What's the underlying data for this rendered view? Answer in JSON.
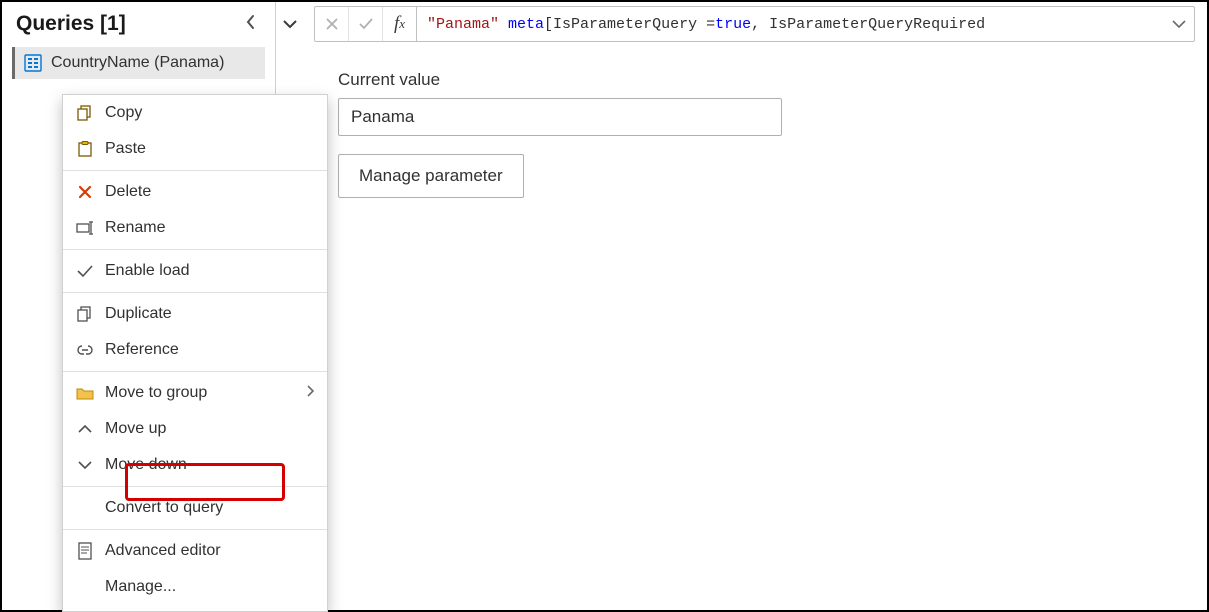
{
  "sidebar": {
    "title": "Queries [1]",
    "item_label": "CountryName (Panama)"
  },
  "formula": {
    "str": "\"Panama\"",
    "kw": "meta",
    "rest1": " [IsParameterQuery = ",
    "val": "true",
    "rest2": ", IsParameterQueryRequired"
  },
  "main": {
    "current_value_label": "Current value",
    "current_value": "Panama",
    "manage_button": "Manage parameter"
  },
  "ctx": {
    "copy": "Copy",
    "paste": "Paste",
    "delete": "Delete",
    "rename": "Rename",
    "enable_load": "Enable load",
    "duplicate": "Duplicate",
    "reference": "Reference",
    "move_to_group": "Move to group",
    "move_up": "Move up",
    "move_down": "Move down",
    "convert_to_query": "Convert to query",
    "advanced_editor": "Advanced editor",
    "manage": "Manage..."
  }
}
